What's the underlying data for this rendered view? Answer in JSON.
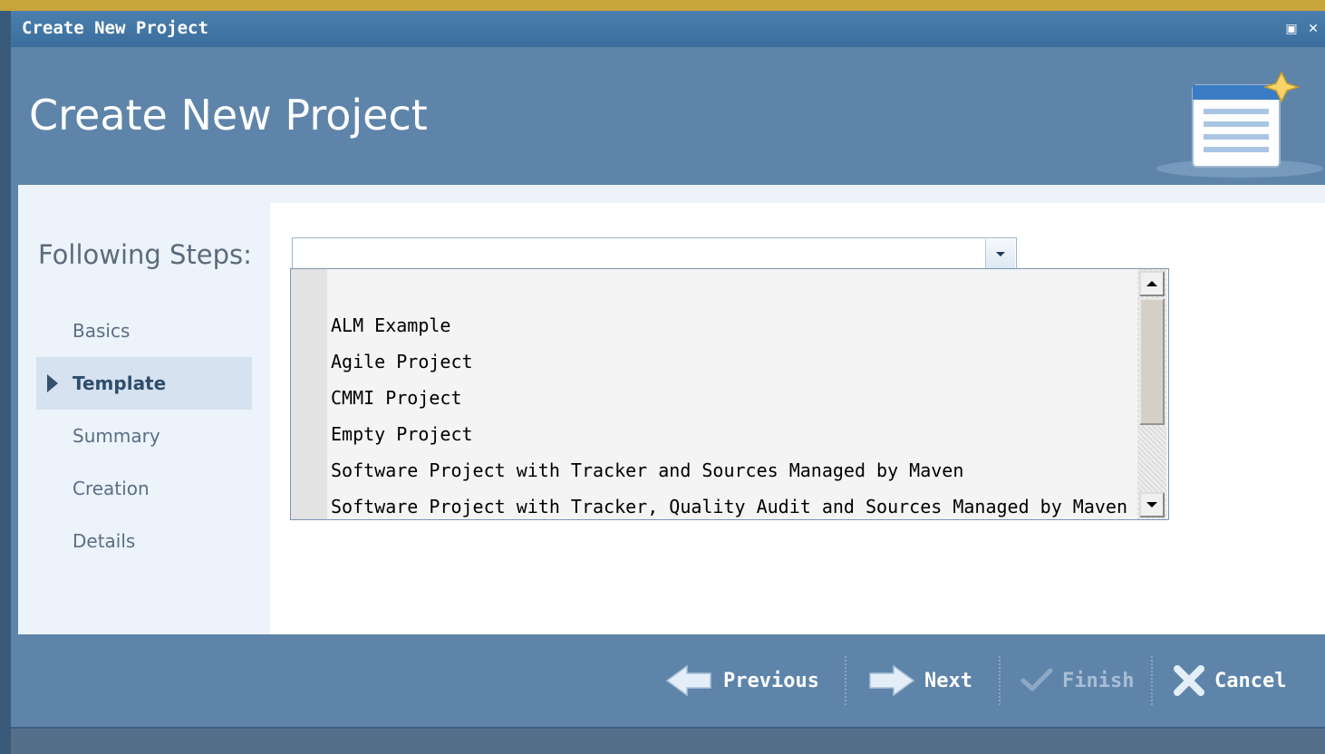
{
  "window": {
    "title": "Create New Project"
  },
  "header": {
    "title": "Create New Project",
    "icon": "project-document-icon"
  },
  "steps": {
    "title": "Following Steps:",
    "items": [
      {
        "label": "Basics",
        "active": false
      },
      {
        "label": "Template",
        "active": true
      },
      {
        "label": "Summary",
        "active": false
      },
      {
        "label": "Creation",
        "active": false
      },
      {
        "label": "Details",
        "active": false
      }
    ]
  },
  "template_select": {
    "value": "",
    "options": [
      "ALM Example",
      "Agile Project",
      "CMMI Project",
      "Empty Project",
      "Software Project with Tracker and Sources Managed by Maven",
      "Software Project with Tracker, Quality Audit and Sources Managed by Maven"
    ]
  },
  "footer": {
    "previous": "Previous",
    "next": "Next",
    "finish": "Finish",
    "cancel": "Cancel"
  },
  "colors": {
    "header_bg": "#5e84aa",
    "content_bg": "#edf3fb",
    "active_step_bg": "#d6e2ef"
  }
}
